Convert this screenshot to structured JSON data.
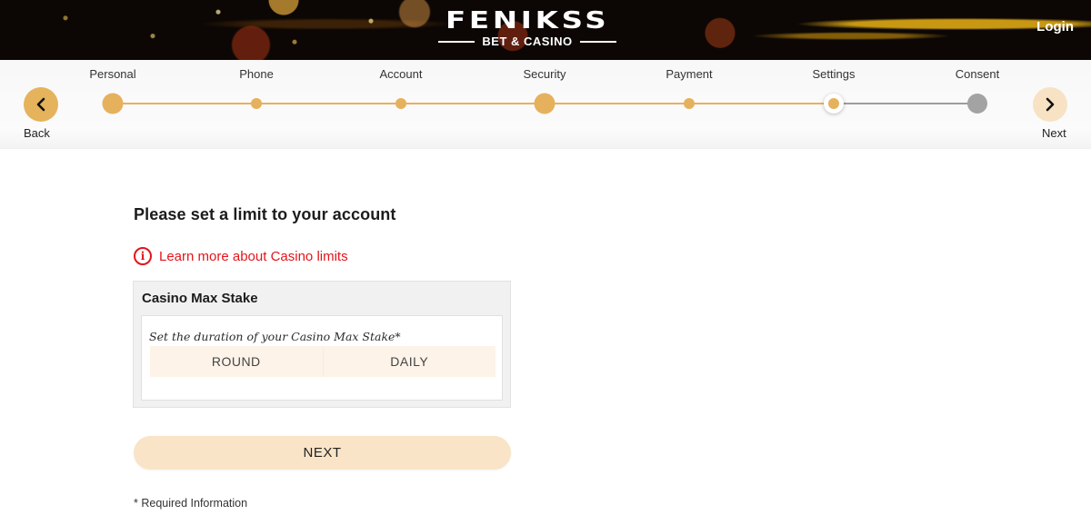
{
  "header": {
    "brand_name": "FENIKSS",
    "brand_tagline": "BET & CASINO",
    "login_label": "Login"
  },
  "stepper": {
    "back_label": "Back",
    "next_label": "Next",
    "current_step": "Settings",
    "steps": [
      {
        "label": "Personal",
        "state": "completed-major"
      },
      {
        "label": "Phone",
        "state": "completed"
      },
      {
        "label": "Account",
        "state": "completed"
      },
      {
        "label": "Security",
        "state": "completed-major"
      },
      {
        "label": "Payment",
        "state": "completed"
      },
      {
        "label": "Settings",
        "state": "current"
      },
      {
        "label": "Consent",
        "state": "pending"
      }
    ],
    "colors": {
      "done": "#e6b15d",
      "pending": "#a3a3a3"
    }
  },
  "main": {
    "title": "Please set a limit to your account",
    "info_link": "Learn more about Casino limits",
    "info_icon": "info-circle-icon",
    "stake_card": {
      "title": "Casino Max Stake",
      "prompt": "Set the duration of your Casino Max Stake*",
      "options": [
        "ROUND",
        "DAILY"
      ]
    },
    "next_button": "NEXT",
    "required_note": "* Required Information"
  },
  "colors": {
    "accent": "#e6b15d",
    "link_red": "#e3151a",
    "button_bg": "#f9e4c7"
  }
}
